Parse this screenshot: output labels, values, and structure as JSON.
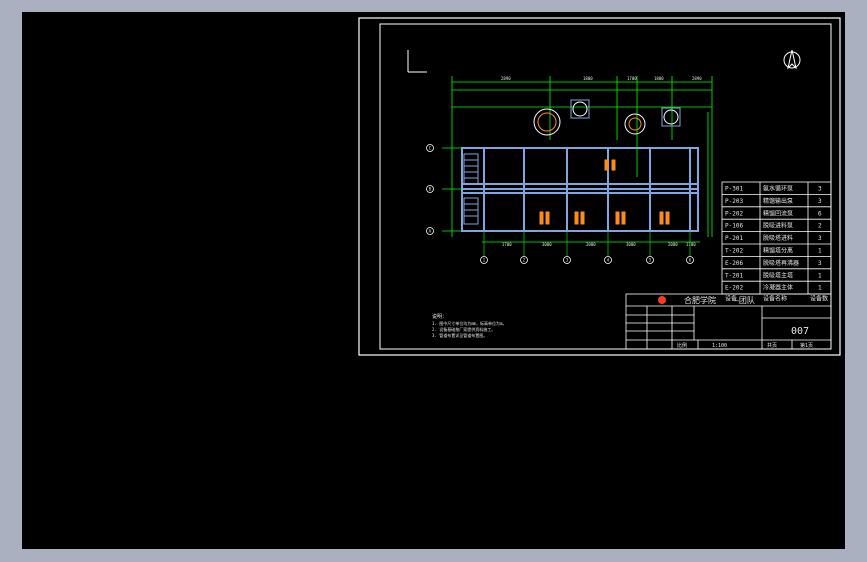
{
  "drawing": {
    "north_symbol": "north-arrow-icon",
    "dimensions_top": [
      "2890",
      "1800",
      "1700",
      "1800",
      "2890"
    ],
    "dimensions_bottom": [
      "1700",
      "3000",
      "2000",
      "3000",
      "2000",
      "1700"
    ],
    "grid_letters": [
      "C",
      "B",
      "A"
    ],
    "grid_numbers": [
      "1",
      "2",
      "3",
      "4",
      "5",
      "6"
    ]
  },
  "equipment_table": {
    "rows": [
      {
        "code": "P-301",
        "name": "氨水循环泵",
        "qty": "3"
      },
      {
        "code": "P-203",
        "name": "精馏输出泵",
        "qty": "3"
      },
      {
        "code": "P-202",
        "name": "精馏回流泵",
        "qty": "6"
      },
      {
        "code": "P-106",
        "name": "脱吸进料泵",
        "qty": "2"
      },
      {
        "code": "P-201",
        "name": "脱吸塔进料",
        "qty": "3"
      },
      {
        "code": "T-202",
        "name": "精馏塔分离",
        "qty": "1"
      },
      {
        "code": "E-206",
        "name": "脱吸塔再沸器",
        "qty": "3"
      },
      {
        "code": "T-201",
        "name": "脱吸塔主塔",
        "qty": "1"
      },
      {
        "code": "E-202",
        "name": "冷凝器主体",
        "qty": "1"
      }
    ],
    "header": {
      "code": "设备",
      "name": "设备名称",
      "qty": "设备数"
    }
  },
  "title_block": {
    "org": "合肥学院",
    "team": "—团队",
    "drawing_no": "007",
    "scale_label": "比例",
    "scale_value": "1:100",
    "sheet_label": "共页",
    "sheet_value": "第1页"
  },
  "notes": {
    "heading": "说明：",
    "lines": [
      "1. 图中尺寸单位均为mm，标高单位为m。",
      "2. 设备基础按厂家提供资料施工。",
      "3. 管道布置详见管道布置图。"
    ]
  },
  "colors": {
    "background": "#000000",
    "frame": "#ffffff",
    "dimension": "#00ff00",
    "structure": "#7ea6e0",
    "equipment": "#ff8c1a",
    "text": "#e6e6e6"
  }
}
